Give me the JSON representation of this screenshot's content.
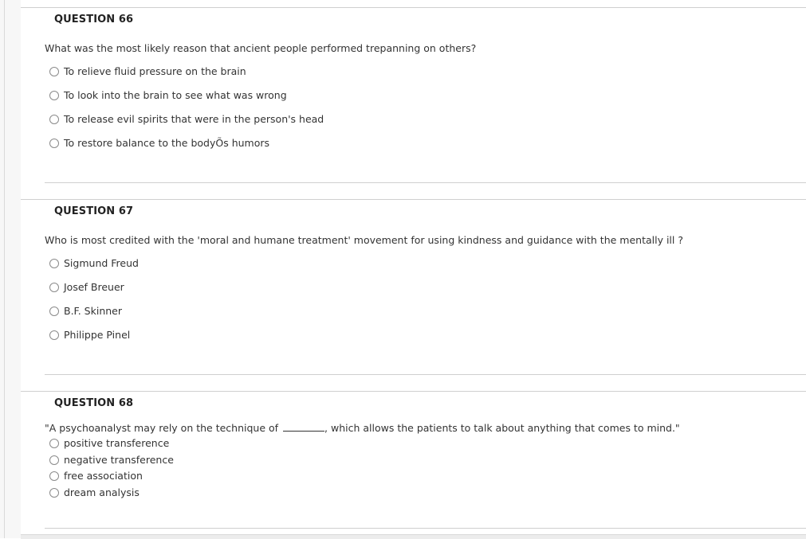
{
  "questions": [
    {
      "heading": "QUESTION 66",
      "text": "What was the most likely reason that ancient people performed trepanning on others?",
      "options": [
        "To relieve fluid pressure on the brain",
        "To look into the brain to see what was wrong",
        "To release evil spirits that were in the person's head",
        "To restore balance to the bodyÕs humors"
      ]
    },
    {
      "heading": "QUESTION 67",
      "text": "Who is most credited with the 'moral and humane treatment' movement for using kindness and guidance with the mentally ill ?",
      "options": [
        "Sigmund Freud",
        "Josef Breuer",
        "B.F. Skinner",
        "Philippe Pinel"
      ]
    },
    {
      "heading": "QUESTION 68",
      "text_before_blank": "\"A psychoanalyst may rely on the technique of ",
      "text_after_blank": ", which allows the patients to talk about anything that comes to mind.\"",
      "options": [
        "positive transference",
        "negative transference",
        "free association",
        "dream analysis"
      ]
    }
  ]
}
